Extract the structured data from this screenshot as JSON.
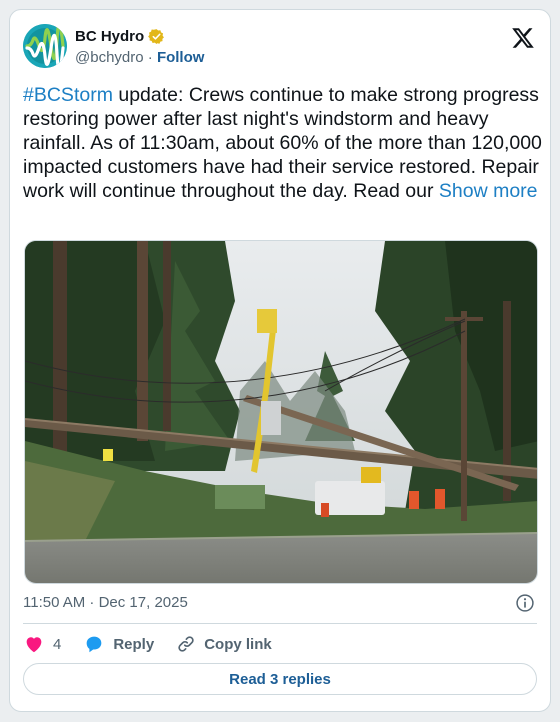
{
  "author": {
    "name": "BC Hydro",
    "handle": "@bchydro",
    "separator": "·",
    "follow_label": "Follow"
  },
  "post": {
    "hashtag": "#BCStorm",
    "text": " update: Crews continue to make strong progress restoring power after last night's windstorm and heavy rainfall. As of 11:30am, about 60% of the more than 120,000 impacted customers have had their service restored. Repair work will continue throughout the day. Read our ",
    "show_more": "Show more"
  },
  "meta": {
    "timestamp": "11:50 AM · Dec 17, 2025"
  },
  "actions": {
    "like_count": "4",
    "reply_label": "Reply",
    "copy_link_label": "Copy link"
  },
  "replies_button": "Read 3 replies",
  "colors": {
    "link": "#1d7fc4",
    "follow": "#1d5e96",
    "like": "#f91880",
    "reply_icon": "#1d9bf0",
    "avatar": "#1aa6b7"
  }
}
